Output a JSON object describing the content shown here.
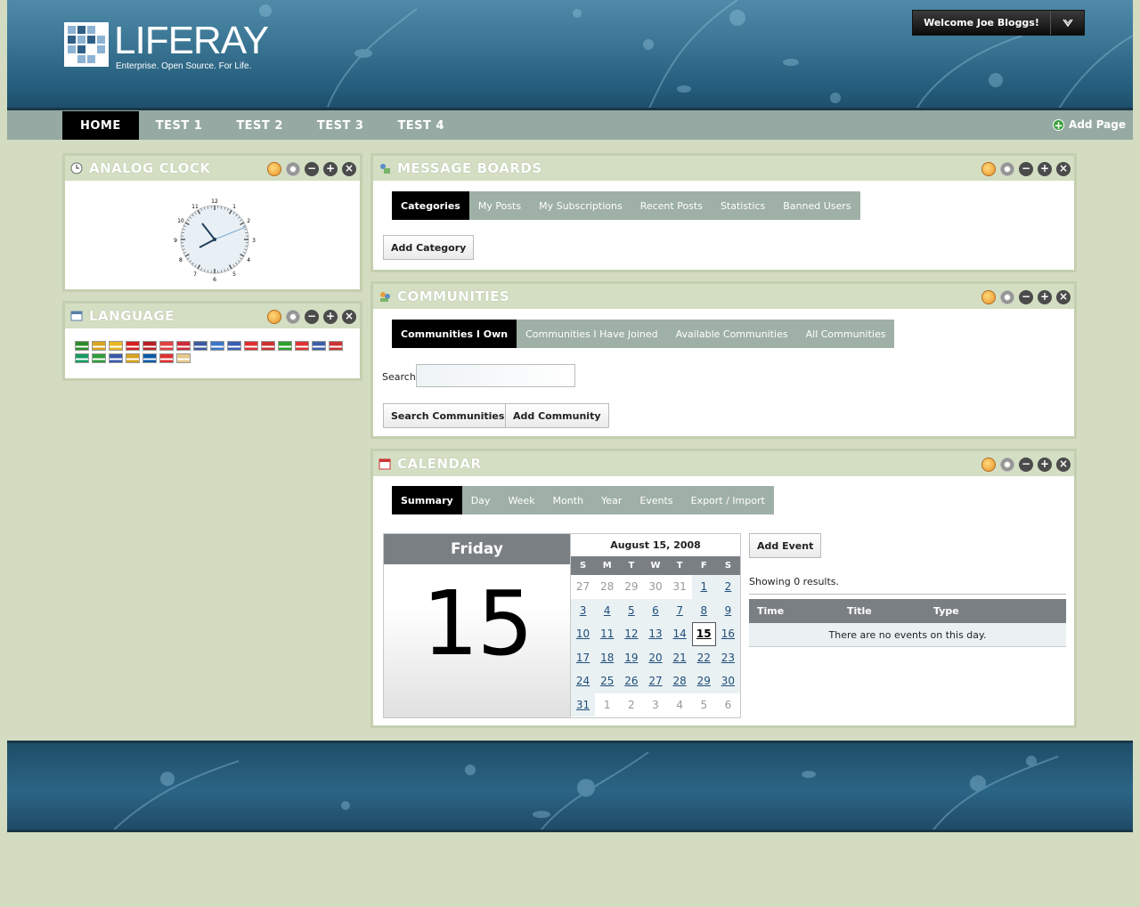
{
  "header": {
    "logo_word": "LIFERAY",
    "logo_tagline": "Enterprise. Open Source. For Life.",
    "welcome": "Welcome Joe Bloggs!"
  },
  "nav": {
    "items": [
      "HOME",
      "TEST 1",
      "TEST 2",
      "TEST 3",
      "TEST 4"
    ],
    "add_page": "Add Page"
  },
  "clock": {
    "title": "ANALOG CLOCK",
    "numbers": [
      "12",
      "1",
      "2",
      "3",
      "4",
      "5",
      "6",
      "7",
      "8",
      "9",
      "10",
      "11"
    ]
  },
  "language": {
    "title": "LANGUAGE",
    "flag_colors": [
      "#2b8a2b",
      "#d8a320",
      "#e8b820",
      "#d62020",
      "#b52026",
      "#e04040",
      "#ce2b37",
      "#3c5aa0",
      "#3b76c6",
      "#3b5fb0",
      "#e03030",
      "#cc3030",
      "#2fa02f",
      "#d33",
      "#3c5fa8",
      "#c33",
      "#169b62",
      "#2f9d3b",
      "#3a5aa8",
      "#d8a320",
      "#0a5aa8",
      "#e03030",
      "#e6c98a"
    ]
  },
  "message_boards": {
    "title": "MESSAGE BOARDS",
    "tabs": [
      "Categories",
      "My Posts",
      "My Subscriptions",
      "Recent Posts",
      "Statistics",
      "Banned Users"
    ],
    "add_button": "Add Category"
  },
  "communities": {
    "title": "COMMUNITIES",
    "tabs": [
      "Communities I Own",
      "Communities I Have Joined",
      "Available Communities",
      "All Communities"
    ],
    "search_label": "Search",
    "search_value": "",
    "search_button": "Search Communities",
    "add_button": "Add Community"
  },
  "calendar": {
    "title": "CALENDAR",
    "tabs": [
      "Summary",
      "Day",
      "Week",
      "Month",
      "Year",
      "Events",
      "Export / Import"
    ],
    "day_name": "Friday",
    "day_number": "15",
    "month_label": "August 15, 2008",
    "weekdays": [
      "S",
      "M",
      "T",
      "W",
      "T",
      "F",
      "S"
    ],
    "days": [
      {
        "n": "27",
        "in": false
      },
      {
        "n": "28",
        "in": false
      },
      {
        "n": "29",
        "in": false
      },
      {
        "n": "30",
        "in": false
      },
      {
        "n": "31",
        "in": false
      },
      {
        "n": "1",
        "in": true
      },
      {
        "n": "2",
        "in": true
      },
      {
        "n": "3",
        "in": true
      },
      {
        "n": "4",
        "in": true
      },
      {
        "n": "5",
        "in": true
      },
      {
        "n": "6",
        "in": true
      },
      {
        "n": "7",
        "in": true
      },
      {
        "n": "8",
        "in": true
      },
      {
        "n": "9",
        "in": true
      },
      {
        "n": "10",
        "in": true
      },
      {
        "n": "11",
        "in": true
      },
      {
        "n": "12",
        "in": true
      },
      {
        "n": "13",
        "in": true
      },
      {
        "n": "14",
        "in": true
      },
      {
        "n": "15",
        "in": true,
        "today": true
      },
      {
        "n": "16",
        "in": true
      },
      {
        "n": "17",
        "in": true
      },
      {
        "n": "18",
        "in": true
      },
      {
        "n": "19",
        "in": true
      },
      {
        "n": "20",
        "in": true
      },
      {
        "n": "21",
        "in": true
      },
      {
        "n": "22",
        "in": true
      },
      {
        "n": "23",
        "in": true
      },
      {
        "n": "24",
        "in": true
      },
      {
        "n": "25",
        "in": true
      },
      {
        "n": "26",
        "in": true
      },
      {
        "n": "27",
        "in": true
      },
      {
        "n": "28",
        "in": true
      },
      {
        "n": "29",
        "in": true
      },
      {
        "n": "30",
        "in": true
      },
      {
        "n": "31",
        "in": true
      },
      {
        "n": "1",
        "in": false
      },
      {
        "n": "2",
        "in": false
      },
      {
        "n": "3",
        "in": false
      },
      {
        "n": "4",
        "in": false
      },
      {
        "n": "5",
        "in": false
      },
      {
        "n": "6",
        "in": false
      }
    ],
    "add_event": "Add Event",
    "showing": "Showing 0 results.",
    "columns": [
      "Time",
      "Title",
      "Type"
    ],
    "empty_message": "There are no events on this day."
  }
}
